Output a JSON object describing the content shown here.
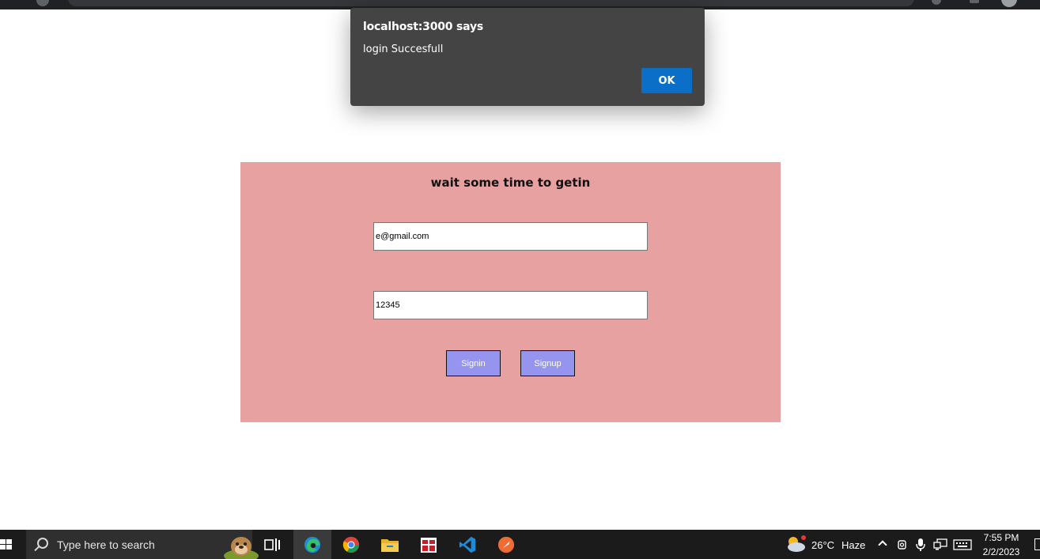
{
  "alert": {
    "origin": "localhost:3000 says",
    "message": "login Succesfull",
    "ok_label": "OK"
  },
  "login": {
    "title": "wait some time to getin",
    "email_value": "e@gmail.com",
    "password_value": "12345",
    "signin_label": "Signin",
    "signup_label": "Signup",
    "panel_color": "#e8a1a1",
    "button_color": "#9595ef"
  },
  "taskbar": {
    "search_placeholder": "Type here to search",
    "apps": [
      "task-view",
      "edge",
      "chrome",
      "file-explorer",
      "gift-app",
      "vscode",
      "postman"
    ],
    "weather_temp": "26°C",
    "weather_condition": "Haze",
    "time": "7:55 PM",
    "date": "2/2/2023"
  }
}
